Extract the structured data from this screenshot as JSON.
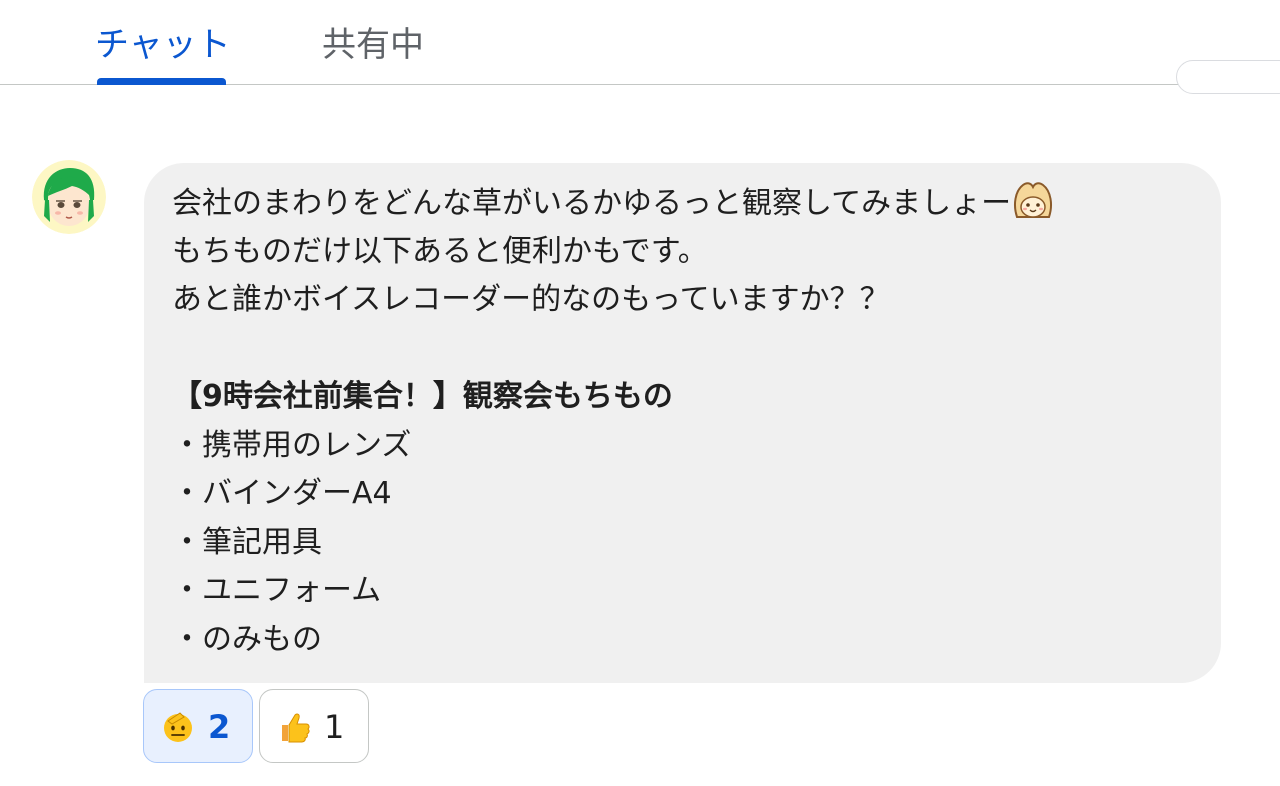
{
  "tabs": {
    "chat": "チャット",
    "shared": "共有中"
  },
  "message": {
    "lines": [
      "会社のまわりをどんな草がいるかゆるっと観察してみましょー",
      "もちものだけ以下あると便利かもです。",
      "あと誰かボイスレコーダー的なのもっていますか？？",
      "",
      "【9時会社前集合！】観察会もちもの",
      "・携帯用のレンズ",
      "・バインダーA4",
      "・筆記用具",
      "・ユニフォーム",
      "・のみもの"
    ],
    "trailing_emoji": "cute-face-emoji"
  },
  "reactions": [
    {
      "emoji": "saluting-face-emoji",
      "count": "2",
      "selected": true
    },
    {
      "emoji": "thumbs-up-emoji",
      "count": "1",
      "selected": false
    }
  ],
  "colors": {
    "accent": "#0b57d0",
    "bubble": "#f0f0f0",
    "selected_reaction_bg": "#e8f0fe"
  }
}
